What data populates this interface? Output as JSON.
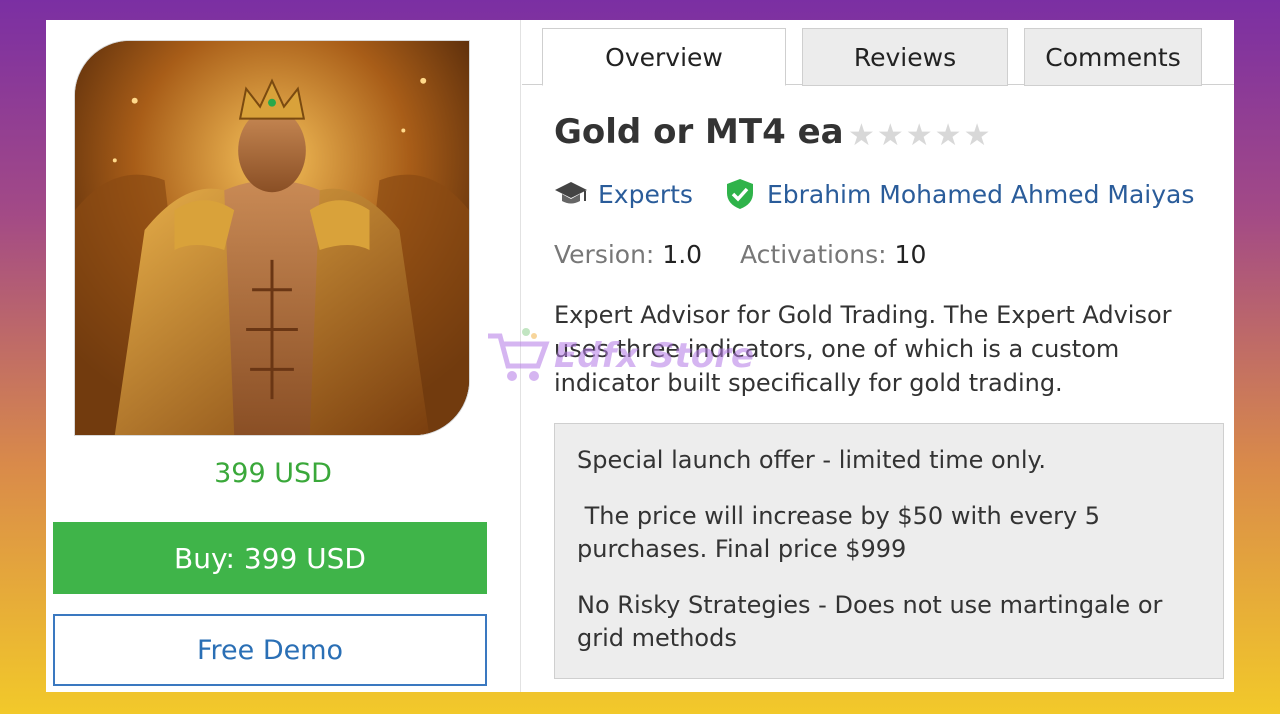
{
  "product": {
    "price": "399 USD",
    "buy_label": "Buy: 399 USD",
    "demo_label": "Free Demo"
  },
  "tabs": [
    {
      "label": "Overview",
      "active": true
    },
    {
      "label": "Reviews",
      "active": false
    },
    {
      "label": "Comments",
      "active": false
    }
  ],
  "details": {
    "title": "Gold or MT4 ea",
    "rating_stars": "★★★★★",
    "rating_value": 0,
    "category": "Experts",
    "category_icon": "graduation-cap-icon",
    "author": "Ebrahim Mohamed Ahmed Maiyas",
    "author_icon": "verified-shield-icon",
    "version_label": "Version:",
    "version_value": "1.0",
    "activations_label": "Activations:",
    "activations_value": "10",
    "description": "Expert Advisor for Gold Trading. The Expert Advisor uses three indicators, one of which is a custom indicator built specifically for gold trading."
  },
  "offer": {
    "lines": [
      "Special launch offer - limited time only.",
      " The price will increase by $50 with every 5 purchases. Final price $999",
      "No Risky Strategies - Does not use martingale or grid methods"
    ]
  },
  "watermark": {
    "text": "Edfx Store"
  },
  "colors": {
    "price_green": "#3aa83a",
    "buy_button": "#3fb449",
    "link_blue": "#2a5c9a",
    "demo_border": "#3a78c0",
    "verified_green": "#2fb34a"
  }
}
